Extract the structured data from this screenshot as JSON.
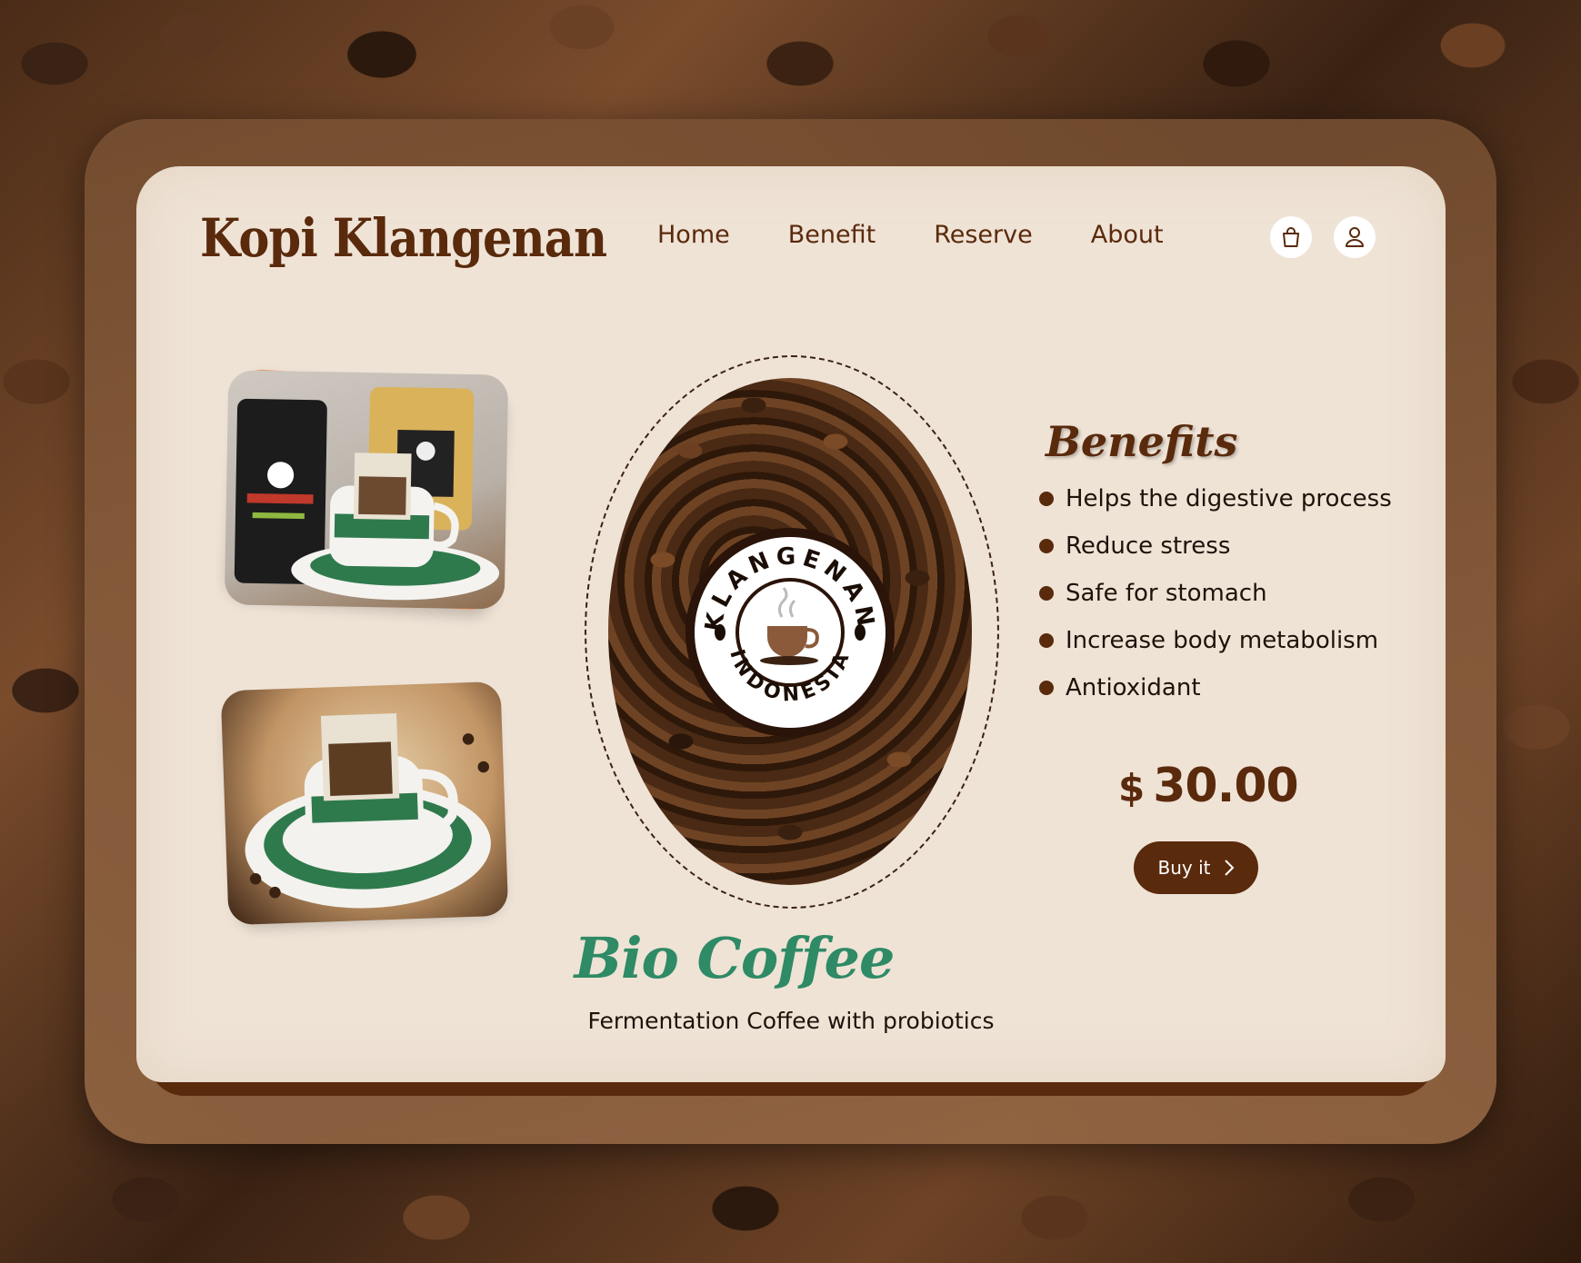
{
  "brand": {
    "name": "Kopi Klangenan"
  },
  "nav": {
    "items": [
      "Home",
      "Benefit",
      "Reserve",
      "About"
    ]
  },
  "header_icons": {
    "cart": "shopping-bag-icon",
    "account": "user-icon"
  },
  "emblem": {
    "top_text": "KLANGENAN",
    "bottom_text": "INDONESIA"
  },
  "benefits": {
    "title": "Benefits",
    "items": [
      "Helps the digestive process",
      "Reduce stress",
      "Safe for stomach",
      "Increase body metabolism",
      "Antioxidant"
    ]
  },
  "product": {
    "currency": "$",
    "price": "30.00",
    "buy_label": "Buy it",
    "name": "Bio Coffee",
    "tagline": "Fermentation Coffee with probiotics"
  },
  "colors": {
    "brand_brown": "#5a2a0c",
    "card_bg": "#efe3d6",
    "accent_green": "#2f8a66"
  }
}
